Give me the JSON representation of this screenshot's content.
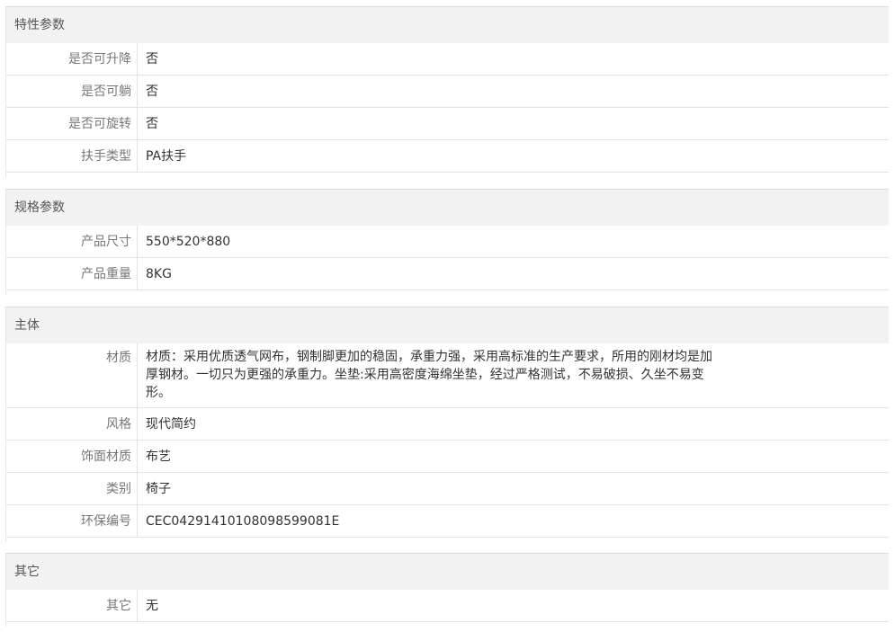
{
  "sections": [
    {
      "title": "特性参数",
      "rows": [
        {
          "label": "是否可升降",
          "value": "否"
        },
        {
          "label": "是否可躺",
          "value": "否"
        },
        {
          "label": "是否可旋转",
          "value": "否"
        },
        {
          "label": "扶手类型",
          "value": "PA扶手"
        }
      ]
    },
    {
      "title": "规格参数",
      "rows": [
        {
          "label": "产品尺寸",
          "value": "550*520*880"
        },
        {
          "label": "产品重量",
          "value": "8KG"
        }
      ]
    },
    {
      "title": "主体",
      "rows": [
        {
          "label": "材质",
          "value": "材质：采用优质透气网布，钢制脚更加的稳固，承重力强，采用高标准的生产要求，所用的刚材均是加厚钢材。一切只为更强的承重力。坐垫:采用高密度海绵坐垫，经过严格测试，不易破损、久坐不易变形。"
        },
        {
          "label": "风格",
          "value": "现代简约"
        },
        {
          "label": "饰面材质",
          "value": "布艺"
        },
        {
          "label": "类别",
          "value": "椅子"
        },
        {
          "label": "环保编号",
          "value": "CEC04291410108098599081E"
        }
      ]
    },
    {
      "title": "其它",
      "rows": [
        {
          "label": "其它",
          "value": "无"
        }
      ]
    }
  ]
}
